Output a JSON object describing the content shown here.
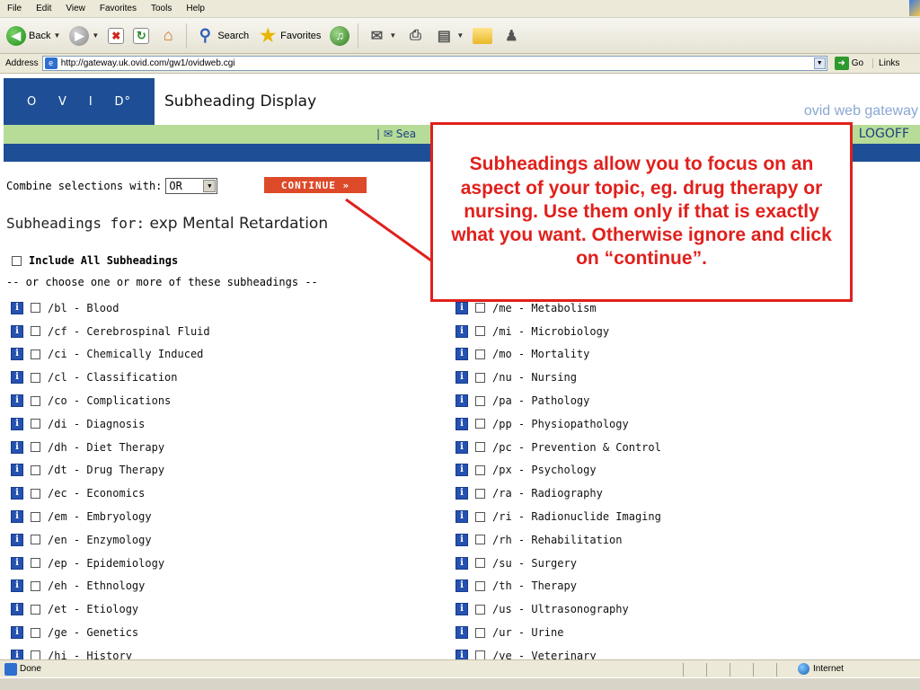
{
  "menubar": {
    "items": [
      "File",
      "Edit",
      "View",
      "Favorites",
      "Tools",
      "Help"
    ]
  },
  "toolbar": {
    "back_label": "Back",
    "search_label": "Search",
    "favorites_label": "Favorites"
  },
  "address": {
    "label": "Address",
    "url": "http://gateway.uk.ovid.com/gw1/ovidweb.cgi",
    "go_label": "Go",
    "links_label": "Links"
  },
  "ovid": {
    "logo_letters": [
      "O",
      "V",
      "I",
      "D°"
    ],
    "page_title": "Subheading Display",
    "gateway_text": "ovid web gateway",
    "search_link": "|",
    "search_link_text": "Sea",
    "logoff": "LOGOFF"
  },
  "combine": {
    "label": "Combine selections with:",
    "selected": "OR",
    "continue_label": "CONTINUE »"
  },
  "subheadings_for": {
    "label": "Subheadings for:",
    "topic": "exp Mental Retardation"
  },
  "include_all_label": "Include All Subheadings",
  "or_choose_label": "-- or choose one or more of these subheadings --",
  "subheadings_left": [
    "/bl - Blood",
    "/cf - Cerebrospinal Fluid",
    "/ci - Chemically Induced",
    "/cl - Classification",
    "/co - Complications",
    "/di - Diagnosis",
    "/dh - Diet Therapy",
    "/dt - Drug Therapy",
    "/ec - Economics",
    "/em - Embryology",
    "/en - Enzymology",
    "/ep - Epidemiology",
    "/eh - Ethnology",
    "/et - Etiology",
    "/ge - Genetics",
    "/hi - History"
  ],
  "subheadings_right": [
    "/me - Metabolism",
    "/mi - Microbiology",
    "/mo - Mortality",
    "/nu - Nursing",
    "/pa - Pathology",
    "/pp - Physiopathology",
    "/pc - Prevention & Control",
    "/px - Psychology",
    "/ra - Radiography",
    "/ri - Radionuclide Imaging",
    "/rh - Rehabilitation",
    "/su - Surgery",
    "/th - Therapy",
    "/us - Ultrasonography",
    "/ur - Urine",
    "/ve - Veterinary"
  ],
  "callout": {
    "text": "Subheadings allow you to focus on an aspect of your topic, eg. drug therapy or nursing.  Use them only if that is exactly what you want. Otherwise ignore and click on “continue”.",
    "color": "#e0201c"
  },
  "statusbar": {
    "status": "Done",
    "zone": "Internet"
  },
  "colors": {
    "ovid_blue": "#1e4f96",
    "ovid_green": "#b6dc98",
    "continue_red": "#dd4a2a"
  }
}
